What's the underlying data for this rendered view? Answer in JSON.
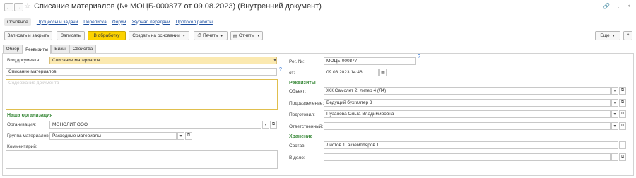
{
  "window": {
    "title": "Списание материалов (№ МОЦБ-000877 от 09.08.2023) (Внутренний документ)"
  },
  "nav_links": [
    "Основное",
    "Процессы и задачи",
    "Переписка",
    "Форум",
    "Журнал передачи",
    "Протокол работы"
  ],
  "toolbar": {
    "write_close": "Записать и закрыть",
    "write": "Записать",
    "process": "В обработку",
    "create_based": "Создать на основании",
    "print": "Печать",
    "reports": "Отчеты",
    "more": "Еще",
    "help": "?"
  },
  "tabs": [
    "Обзор",
    "Реквизиты",
    "Визы",
    "Свойства"
  ],
  "left": {
    "doc_type_label": "Вид документа:",
    "doc_type_value": "Списание материалов",
    "name_value": "Списание материалов",
    "content_placeholder": "Содержание документа",
    "our_org_header": "Наша организация",
    "org_label": "Организация:",
    "org_value": "МОНОЛИТ ООО",
    "group_label": "Группа материалов:",
    "group_value": "Расходные материалы",
    "comment_label": "Комментарий:"
  },
  "right": {
    "reg_label": "Рег. №:",
    "reg_value": "МОЦБ-000877",
    "date_label": "от:",
    "date_value": "09.08.2023 14:46",
    "req_header": "Реквизиты",
    "object_label": "Объект:",
    "object_value": "ЖК Самолет 2,  литер 4 (Л4)",
    "dept_label": "Подразделение:",
    "dept_value": "Ведущий бухгалтер 3",
    "prepared_label": "Подготовил:",
    "prepared_value": "Пузанова Ольга Владимировна",
    "resp_label": "Ответственный:",
    "resp_value": "",
    "storage_header": "Хранение",
    "composition_label": "Состав:",
    "composition_value": "Листов 1, экземпляров 1",
    "file_label": "В дело:",
    "file_value": ""
  }
}
